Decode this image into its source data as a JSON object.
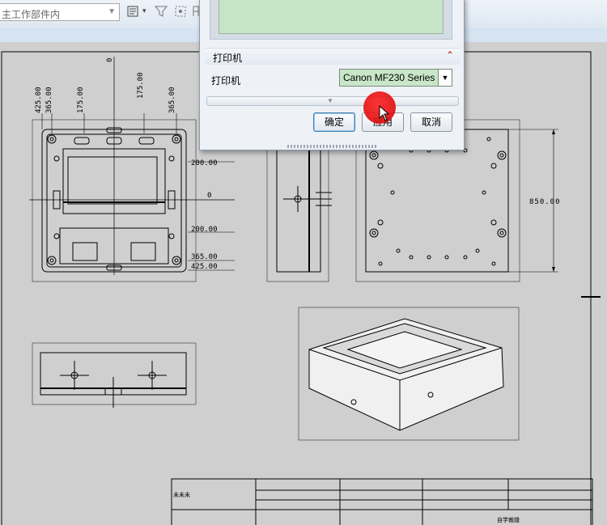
{
  "toolbar": {
    "component_filter_text": "主工作部件内",
    "icons": [
      "filter-select-icon",
      "dropdown-arrow-icon",
      "filter-icon",
      "snap-icon",
      "grid-icon"
    ]
  },
  "dialog": {
    "group_title": "打印机",
    "printer_label": "打印机",
    "printer_value": "Canon MF230 Series",
    "ok_label": "确定",
    "apply_label": "应用",
    "cancel_label": "取消",
    "collapse_icon": "double-chevron-up-icon"
  },
  "drawing": {
    "dims_top": [
      "425.00",
      "365.00",
      "175.00",
      "0",
      "175.00",
      "365.00"
    ],
    "dims_right_front": [
      "200.00",
      "0",
      "200.00",
      "365.00",
      "425.00"
    ],
    "dim_right_view": "850.00",
    "title_block_cell": "未未未",
    "title_block_footer": "自学裁缝"
  },
  "colors": {
    "dialog_bg": "#eef2f7",
    "printer_field_bg": "#c8e6c8",
    "click_marker": "#e00000"
  }
}
